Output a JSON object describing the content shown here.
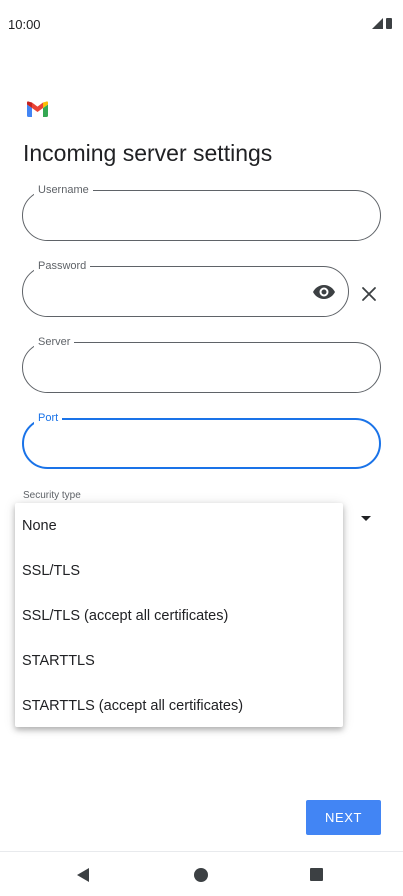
{
  "status_bar": {
    "time": "10:00"
  },
  "app": {
    "logo_icon": "gmail-logo-icon",
    "colors": {
      "red": "#ea4335",
      "blue": "#4285f4",
      "green": "#34a853",
      "yellow": "#fbbc04"
    }
  },
  "page": {
    "title": "Incoming server settings"
  },
  "fields": {
    "username": {
      "label": "Username",
      "value": ""
    },
    "password": {
      "label": "Password",
      "value": ""
    },
    "server": {
      "label": "Server",
      "value": ""
    },
    "port": {
      "label": "Port",
      "value": "",
      "focused": true
    }
  },
  "security": {
    "label": "Security type",
    "options": [
      "None",
      "SSL/TLS",
      "SSL/TLS (accept all certificates)",
      "STARTTLS",
      "STARTTLS (accept all certificates)"
    ]
  },
  "actions": {
    "next_label": "NEXT"
  },
  "theme": {
    "accent": "#1a73e8",
    "button": "#4285f4",
    "outline": "#5f6368"
  }
}
